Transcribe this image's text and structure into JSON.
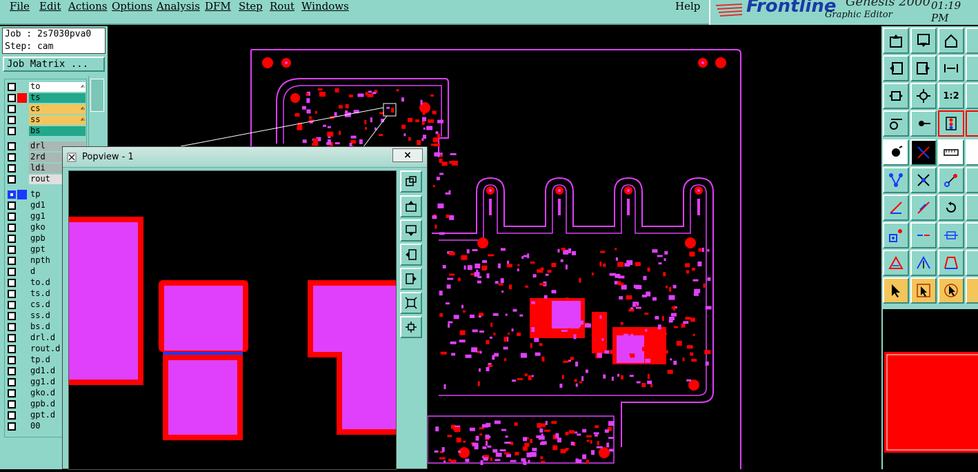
{
  "menu": {
    "items": [
      "File",
      "Edit",
      "Actions",
      "Options",
      "Analysis",
      "DFM",
      "Step",
      "Rout",
      "Windows"
    ],
    "help": "Help"
  },
  "brand": {
    "logo": "Frontline",
    "product": "Genesis 2000",
    "subtitle": "Graphic Editor",
    "time": "01:19 PM"
  },
  "job": {
    "job_line": "Job : 2s7030pva0",
    "step_line": "Step: cam",
    "matrix_button": "Job Matrix ..."
  },
  "layers": [
    {
      "name": "to",
      "bg": "#ffffff",
      "swatch": "",
      "arrow": true
    },
    {
      "name": "ts",
      "bg": "#22a88a",
      "swatch": "#ff0000",
      "arrow": false
    },
    {
      "name": "cs",
      "bg": "#f4c55a",
      "swatch": "",
      "arrow": true
    },
    {
      "name": "ss",
      "bg": "#f4c55a",
      "swatch": "",
      "arrow": true
    },
    {
      "name": "bs",
      "bg": "#22a88a",
      "swatch": "",
      "arrow": false
    },
    {
      "name": "drl",
      "bg": "#a9b8b4",
      "swatch": "",
      "arrow": false
    },
    {
      "name": "2rd",
      "bg": "#a9b8b4",
      "swatch": "",
      "arrow": false
    },
    {
      "name": "ldi",
      "bg": "#a9b8b4",
      "swatch": "",
      "arrow": false
    },
    {
      "name": "rout",
      "bg": "#e0e0e0",
      "swatch": "",
      "arrow": false
    },
    {
      "name": "tp",
      "bg": "#8fd6c8",
      "swatch": "#1a3aff",
      "arrow": false,
      "checked": true
    },
    {
      "name": "gd1",
      "bg": "#8fd6c8",
      "swatch": "",
      "arrow": false
    },
    {
      "name": "gg1",
      "bg": "#8fd6c8",
      "swatch": "",
      "arrow": false
    },
    {
      "name": "gko",
      "bg": "#8fd6c8",
      "swatch": "",
      "arrow": false
    },
    {
      "name": "gpb",
      "bg": "#8fd6c8",
      "swatch": "",
      "arrow": false
    },
    {
      "name": "gpt",
      "bg": "#8fd6c8",
      "swatch": "",
      "arrow": false
    },
    {
      "name": "npth",
      "bg": "#8fd6c8",
      "swatch": "",
      "arrow": false
    },
    {
      "name": "d",
      "bg": "#8fd6c8",
      "swatch": "",
      "arrow": false
    },
    {
      "name": "to.d",
      "bg": "#8fd6c8",
      "swatch": "",
      "arrow": false
    },
    {
      "name": "ts.d",
      "bg": "#8fd6c8",
      "swatch": "",
      "arrow": false
    },
    {
      "name": "cs.d",
      "bg": "#8fd6c8",
      "swatch": "",
      "arrow": false
    },
    {
      "name": "ss.d",
      "bg": "#8fd6c8",
      "swatch": "",
      "arrow": false
    },
    {
      "name": "bs.d",
      "bg": "#8fd6c8",
      "swatch": "",
      "arrow": false
    },
    {
      "name": "drl.d",
      "bg": "#8fd6c8",
      "swatch": "",
      "arrow": false
    },
    {
      "name": "rout.d",
      "bg": "#8fd6c8",
      "swatch": "",
      "arrow": false
    },
    {
      "name": "tp.d",
      "bg": "#8fd6c8",
      "swatch": "",
      "arrow": false
    },
    {
      "name": "gd1.d",
      "bg": "#8fd6c8",
      "swatch": "",
      "arrow": false
    },
    {
      "name": "gg1.d",
      "bg": "#8fd6c8",
      "swatch": "",
      "arrow": false
    },
    {
      "name": "gko.d",
      "bg": "#8fd6c8",
      "swatch": "",
      "arrow": false
    },
    {
      "name": "gpb.d",
      "bg": "#8fd6c8",
      "swatch": "",
      "arrow": false
    },
    {
      "name": "gpt.d",
      "bg": "#8fd6c8",
      "swatch": "",
      "arrow": false
    },
    {
      "name": "00",
      "bg": "#8fd6c8",
      "swatch": "",
      "arrow": false
    }
  ],
  "popup": {
    "title": "Popview - 1",
    "close": "×"
  },
  "right_tools": {
    "ratio_label": "1:2"
  },
  "colors": {
    "panel": "#8fd6c8",
    "pad_red": "#ff0000",
    "pad_magenta": "#e040fb",
    "outline": "#e040fb"
  }
}
